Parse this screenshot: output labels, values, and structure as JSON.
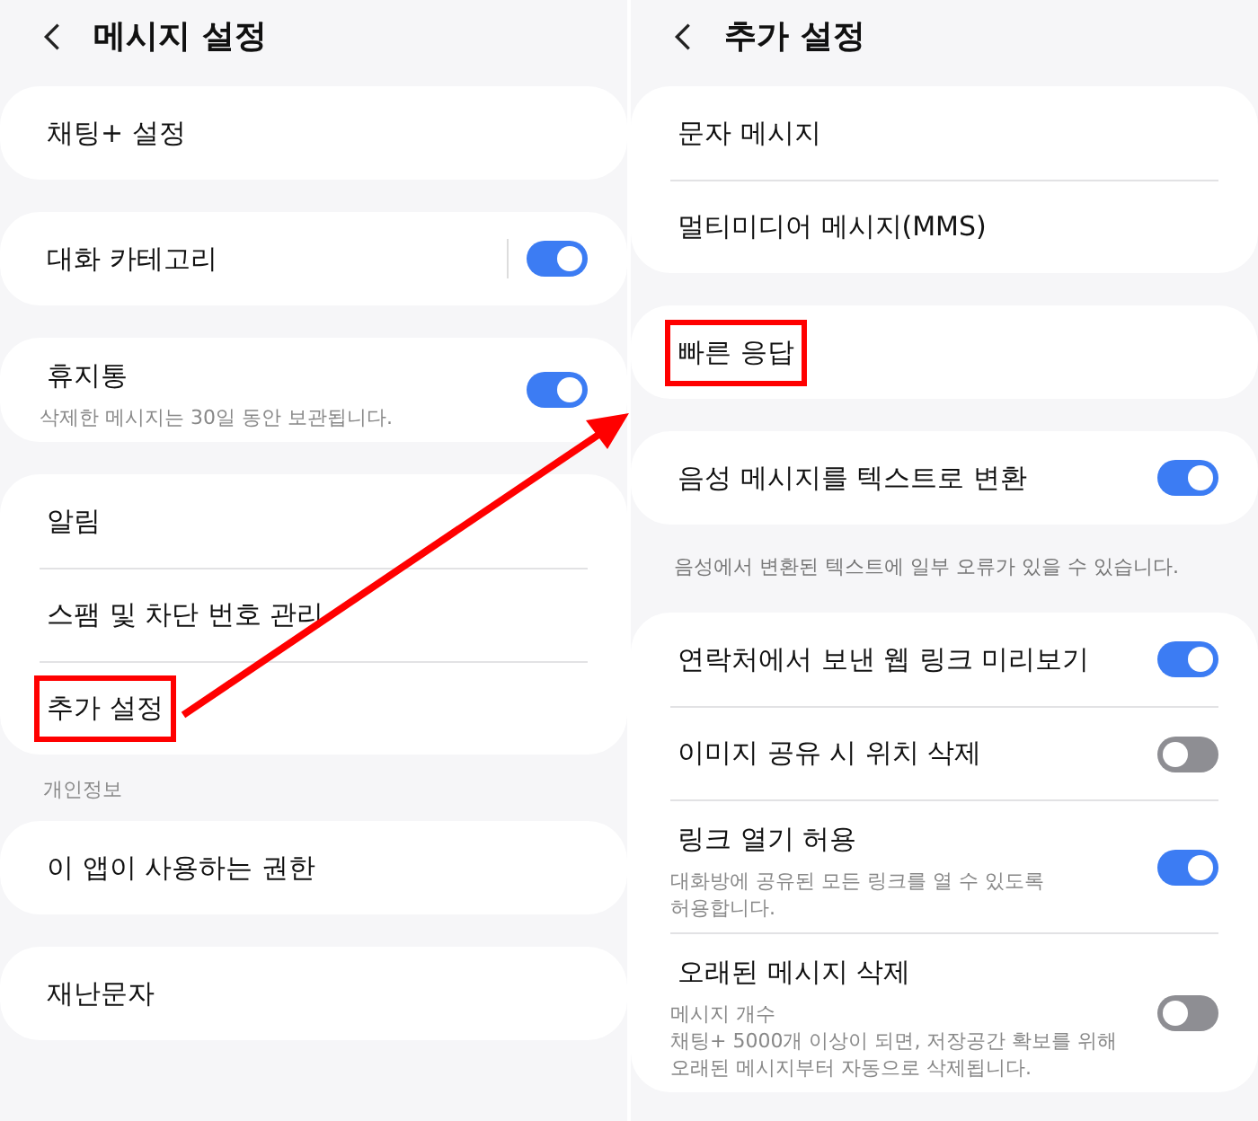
{
  "panels": [
    {
      "title": "메시지 설정",
      "blocks": [
        {
          "kind": "card",
          "items": [
            {
              "label": "채팅+ 설정",
              "highlighted": false
            }
          ]
        },
        {
          "kind": "card",
          "items": [
            {
              "label": "대화 카테고리",
              "highlighted": false,
              "toggle": {
                "on": true,
                "split": true
              }
            }
          ]
        },
        {
          "kind": "card",
          "items": [
            {
              "label": "휴지통",
              "description": [
                "삭제한 메시지는 30일 동안 보관됩니다."
              ],
              "highlighted": false,
              "toggle": {
                "on": true,
                "split": false
              }
            }
          ]
        },
        {
          "kind": "card",
          "items": [
            {
              "label": "알림",
              "highlighted": false
            },
            {
              "label": "스팸 및 차단 번호 관리",
              "highlighted": false
            },
            {
              "label": "추가 설정",
              "highlighted": true
            }
          ]
        },
        {
          "kind": "section_label",
          "text": "개인정보"
        },
        {
          "kind": "card",
          "items": [
            {
              "label": "이 앱이 사용하는 권한",
              "highlighted": false
            }
          ]
        },
        {
          "kind": "card",
          "items": [
            {
              "label": "재난문자",
              "highlighted": false
            }
          ]
        }
      ]
    },
    {
      "title": "추가 설정",
      "blocks": [
        {
          "kind": "card",
          "items": [
            {
              "label": "문자 메시지",
              "highlighted": false
            },
            {
              "label": "멀티미디어 메시지(MMS)",
              "highlighted": false
            }
          ]
        },
        {
          "kind": "card",
          "items": [
            {
              "label": "빠른 응답",
              "highlighted": true
            }
          ]
        },
        {
          "kind": "card",
          "items": [
            {
              "label": "음성 메시지를 텍스트로 변환",
              "highlighted": false,
              "toggle": {
                "on": true,
                "split": false
              }
            }
          ]
        },
        {
          "kind": "note",
          "text": "음성에서 변환된 텍스트에 일부 오류가 있을 수 있습니다."
        },
        {
          "kind": "card",
          "items": [
            {
              "label": "연락처에서 보낸 웹 링크 미리보기",
              "highlighted": false,
              "toggle": {
                "on": true,
                "split": false
              }
            },
            {
              "label": "이미지 공유 시 위치 삭제",
              "highlighted": false,
              "toggle": {
                "on": false,
                "split": false
              }
            },
            {
              "label": "링크 열기 허용",
              "description": [
                "대화방에 공유된 모든 링크를 열 수 있도록",
                "허용합니다."
              ],
              "highlighted": false,
              "toggle": {
                "on": true,
                "split": false
              }
            },
            {
              "label": "오래된 메시지 삭제",
              "description": [
                "메시지 개수",
                "채팅+ 5000개 이상이 되면, 저장공간 확보를 위해",
                "오래된 메시지부터 자동으로 삭제됩니다."
              ],
              "highlighted": false,
              "toggle": {
                "on": false,
                "split": false
              }
            }
          ]
        }
      ]
    }
  ],
  "annotation": {
    "arrow": true
  }
}
